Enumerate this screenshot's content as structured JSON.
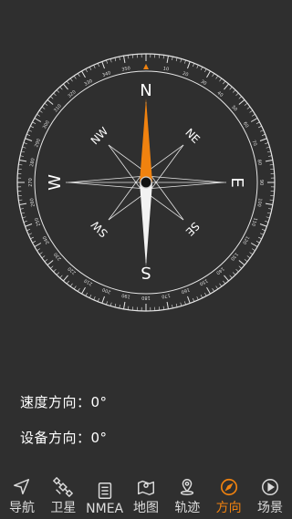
{
  "compass": {
    "cardinals": {
      "north": "N",
      "east": "E",
      "south": "S",
      "west": "W"
    },
    "intercardinals": {
      "ne": "NE",
      "se": "SE",
      "sw": "SW",
      "nw": "NW"
    },
    "needle_north_color": "#f0820f",
    "needle_south_color": "#f2f2f2",
    "ring_color": "#e6e6e6",
    "degree_labels": [
      "350",
      "10",
      "20",
      "30",
      "40",
      "50",
      "60",
      "70",
      "80",
      "90",
      "100",
      "110",
      "120",
      "130",
      "140",
      "150",
      "160",
      "170",
      "180",
      "190",
      "200",
      "210",
      "220",
      "230",
      "240",
      "250",
      "260",
      "270",
      "280",
      "290",
      "300",
      "310",
      "320",
      "330",
      "340"
    ]
  },
  "info": {
    "speed_direction": "速度方向：0°",
    "device_direction": "设备方向：0°"
  },
  "nav": {
    "items": [
      {
        "label": "导航",
        "icon": "navigation-arrow-icon",
        "active": false
      },
      {
        "label": "卫星",
        "icon": "satellite-icon",
        "active": false
      },
      {
        "label": "NMEA",
        "icon": "document-icon",
        "active": false
      },
      {
        "label": "地图",
        "icon": "map-icon",
        "active": false
      },
      {
        "label": "轨迹",
        "icon": "location-pin-icon",
        "active": false
      },
      {
        "label": "方向",
        "icon": "compass-icon",
        "active": true
      },
      {
        "label": "场景",
        "icon": "play-icon",
        "active": false
      }
    ],
    "active_color": "#f0820f"
  }
}
